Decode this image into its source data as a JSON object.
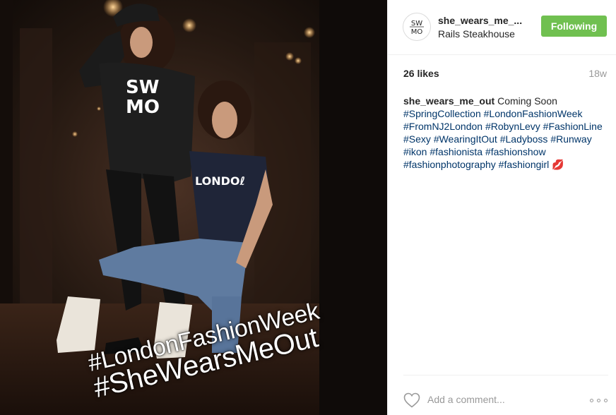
{
  "post": {
    "photo_overlay": {
      "line1": "#LondonFashionWeek",
      "line2": "#SheWearsMeOut"
    },
    "header": {
      "username": "she_wears_me_...",
      "location": "Rails Steakhouse",
      "follow_label": "Following",
      "avatar_text": "SW MO"
    },
    "likes": "26 likes",
    "time_ago": "18w",
    "caption": {
      "username": "she_wears_me_out",
      "text": "Coming Soon",
      "hashtags": [
        "#SpringCollection",
        "#LondonFashionWeek",
        "#FromNJ2London",
        "#RobynLevy",
        "#FashionLine",
        "#Sexy",
        "#WearingItOut",
        "#Ladyboss",
        "#Runway",
        "#ikon",
        "#fashionista",
        "#fashionshow",
        "#fashionphotography",
        "#fashiongirl"
      ],
      "emoji": "💋"
    },
    "comment_placeholder": "Add a comment...",
    "more_label": "More options",
    "colors": {
      "follow_button": "#70c050",
      "hashtag_link": "#003569",
      "muted_text": "#999999"
    },
    "icons": [
      "heart-icon",
      "more-options-icon"
    ]
  }
}
